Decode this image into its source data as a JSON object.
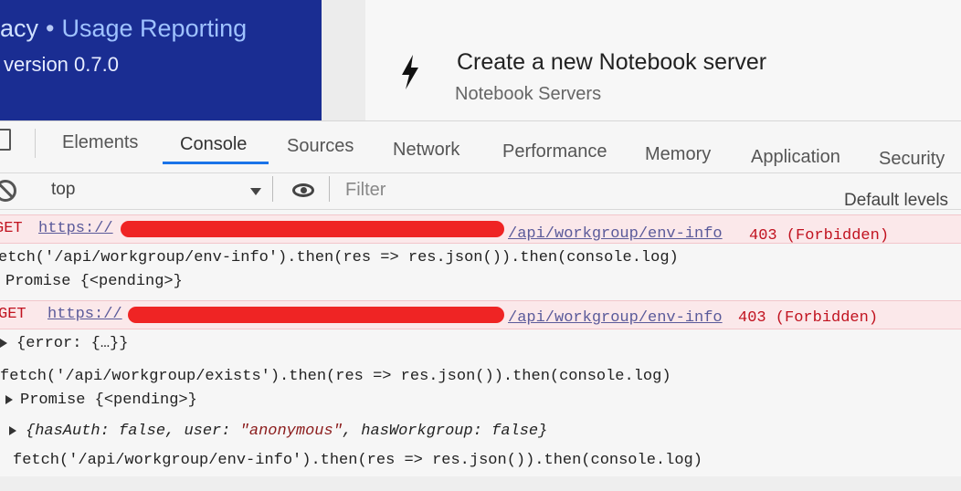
{
  "header": {
    "title_prefix": "acy",
    "title_sep": "•",
    "title_main": "Usage Reporting",
    "version": "version 0.7.0"
  },
  "action_card": {
    "title": "Create a new Notebook server",
    "subtitle": "Notebook Servers",
    "icon": "lightning-bolt-icon"
  },
  "devtools": {
    "tabs": [
      "Elements",
      "Console",
      "Sources",
      "Network",
      "Performance",
      "Memory",
      "Application",
      "Security"
    ],
    "active_tab": "Console",
    "context": "top",
    "filter_placeholder": "Filter",
    "levels": "Default levels"
  },
  "console": {
    "error1": {
      "method": "GET",
      "url_prefix": "https://",
      "url_path": "/api/workgroup/env-info",
      "status": "403 (Forbidden)"
    },
    "cmd1": "etch('/api/workgroup/env-info').then(res => res.json()).then(console.log)",
    "promise1": "Promise {<pending>}",
    "error2": {
      "method": "GET",
      "url_prefix": "https://",
      "url_path": "/api/workgroup/env-info",
      "status": "403 (Forbidden)"
    },
    "obj1": "{error: {…}}",
    "cmd2": "fetch('/api/workgroup/exists').then(res => res.json()).then(console.log)",
    "promise2": "Promise {<pending>}",
    "obj2": {
      "open": "{hasAuth: ",
      "v1": "false",
      "k2": ", user: ",
      "v2": "\"anonymous\"",
      "k3": ", hasWorkgroup: ",
      "v3": "false",
      "close": "}"
    },
    "cmd3": "fetch('/api/workgroup/env-info').then(res => res.json()).then(console.log)"
  },
  "colors": {
    "header_bg": "#1a2d92",
    "active_tab_underline": "#1a73e8",
    "error_text": "#c1121f",
    "redaction": "#ef2424"
  }
}
